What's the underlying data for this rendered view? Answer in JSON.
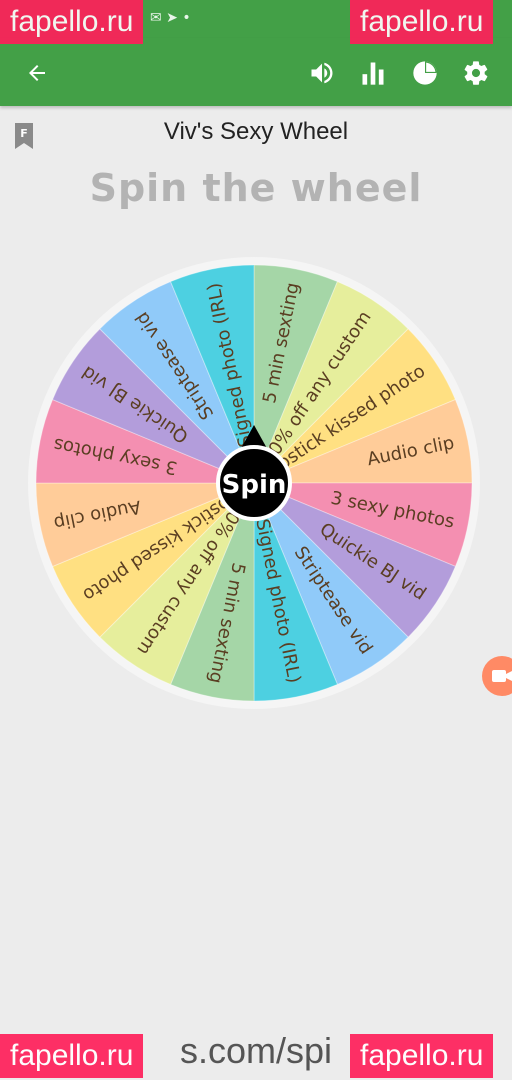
{
  "toolbar": {
    "back_icon": "arrow-left-icon",
    "volume_icon": "volume-icon",
    "stats_icon": "bar-chart-icon",
    "pie_icon": "pie-chart-icon",
    "settings_icon": "gear-icon",
    "color": "#43a047"
  },
  "watermark": {
    "text": "fapello.ru",
    "color": "#ff1f5a"
  },
  "page": {
    "bookmark_letter": "F",
    "title": "Viv's Sexy Wheel",
    "subtitle": "Spin the wheel"
  },
  "wheel": {
    "spin_label": "Spin",
    "segments": [
      {
        "label": "5 min sexting",
        "color": "#a5d6a7"
      },
      {
        "label": "50% off any custom",
        "color": "#e6ee9c"
      },
      {
        "label": "Lipstick kissed photo",
        "color": "#ffe082"
      },
      {
        "label": "Audio clip",
        "color": "#ffcc99"
      },
      {
        "label": "3 sexy photos",
        "color": "#f48fb1"
      },
      {
        "label": "Quickie BJ vid",
        "color": "#b39ddb"
      },
      {
        "label": "Striptease vid",
        "color": "#90caf9"
      },
      {
        "label": "Signed photo (IRL)",
        "color": "#4dd0e1"
      },
      {
        "label": "5 min sexting",
        "color": "#a5d6a7"
      },
      {
        "label": "50% off any custom",
        "color": "#e6ee9c"
      },
      {
        "label": "Lipstick kissed photo",
        "color": "#ffe082"
      },
      {
        "label": "Audio clip",
        "color": "#ffcc99"
      },
      {
        "label": "3 sexy photos",
        "color": "#f48fb1"
      },
      {
        "label": "Quickie BJ vid",
        "color": "#b39ddb"
      },
      {
        "label": "Striptease vid",
        "color": "#90caf9"
      },
      {
        "label": "Signed photo (IRL)",
        "color": "#4dd0e1"
      }
    ]
  },
  "side_button_icon": "video-camera-icon",
  "footer": {
    "url_text": "s.com/spi"
  }
}
